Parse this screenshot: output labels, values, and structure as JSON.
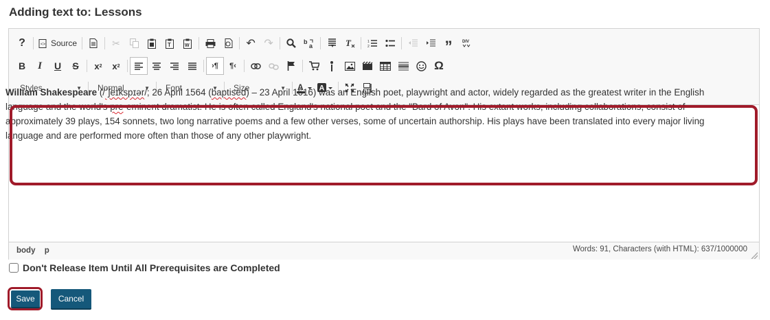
{
  "page": {
    "heading": "Adding text to: Lessons"
  },
  "toolbar": {
    "source_label": "Source",
    "styles_label": "Styles",
    "format_label": "Normal",
    "font_label": "Font",
    "size_label": "Size"
  },
  "content": {
    "name_bold": "William Shakespeare",
    "pron_open": " (/",
    "ipa": "ˈʃeɪkspɪər",
    "after_ipa": "/; 26 April 1564 (",
    "baptised": "baptised",
    "after_baptised": ") – 23 April 1616) was an English poet, playwright and actor, widely regarded as the greatest writer in the English language and the world's ",
    "pre_word": "pre",
    "rest": "-eminent dramatist. He is often called England's national poet and the \"Bard of Avon\". His extant works, including collaborations, consist of approximately 39 plays, 154 sonnets, two long narrative poems and a few other verses, some of uncertain authorship. His plays have been translated into every major living language and are performed more often than those of any other playwright."
  },
  "statusbar": {
    "path_body": "body",
    "path_p": "p",
    "word_count": "Words: 91, Characters (with HTML): 637/1000000"
  },
  "options": {
    "prereq_label": "Don't Release Item Until All Prerequisites are Completed",
    "prereq_checked": false
  },
  "actions": {
    "save_label": "Save",
    "cancel_label": "Cancel"
  },
  "colors": {
    "accent": "#15587a",
    "highlight": "#a01b2a"
  }
}
